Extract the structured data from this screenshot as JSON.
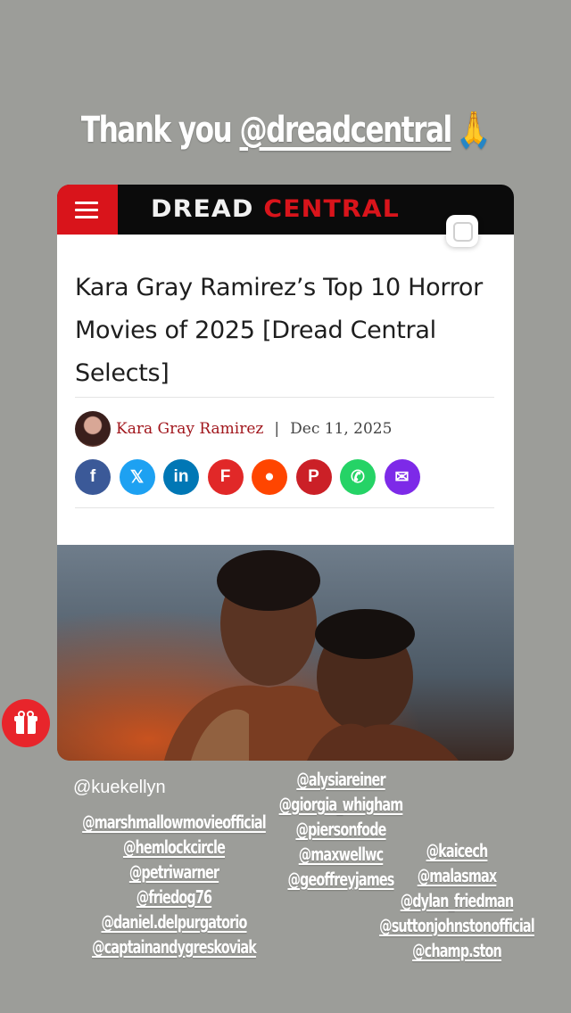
{
  "story": {
    "caption_prefix": "Thank you ",
    "caption_mention": "@dreadcentral",
    "caption_emoji_icon": "folded-hands-emoji"
  },
  "site": {
    "logo_part1": "DREAD",
    "logo_part2": "CENTRAL",
    "brand_red": "#d9141b"
  },
  "article": {
    "title": "Kara Gray Ramirez’s Top 10 Horror Movies of 2025 [Dread Central Selects]",
    "author": "Kara Gray Ramirez",
    "separator": "|",
    "date": "Dec 11, 2025",
    "share_icons": [
      {
        "name": "facebook-icon",
        "glyph": "f",
        "color": "#3b5998"
      },
      {
        "name": "x-icon",
        "glyph": "𝕏",
        "color": "#1da1f2"
      },
      {
        "name": "linkedin-icon",
        "glyph": "in",
        "color": "#0077b5"
      },
      {
        "name": "flipboard-icon",
        "glyph": "F",
        "color": "#e12828"
      },
      {
        "name": "reddit-icon",
        "glyph": "●",
        "color": "#ff4500"
      },
      {
        "name": "pinterest-icon",
        "glyph": "P",
        "color": "#cb2027"
      },
      {
        "name": "whatsapp-icon",
        "glyph": "✆",
        "color": "#25d366"
      },
      {
        "name": "email-icon",
        "glyph": "✉",
        "color": "#7d2ae8"
      }
    ]
  },
  "tags": {
    "plain": "@kuekellyn",
    "left_column": [
      "@marshmallowmovieofficial",
      "@hemlockcircle",
      "@petriwarner",
      "@friedog76",
      "@daniel.delpurgatorio",
      "@captainandygreskoviak"
    ],
    "middle_column": [
      "@alysiareiner",
      "@giorgia_whigham",
      "@piersonfode",
      "@maxwellwc",
      "@geoffreyjames"
    ],
    "right_column": [
      "@kaicech",
      "@malasmax",
      "@dylan_friedman",
      "@suttonjohnstonofficial",
      "@champ.ston"
    ]
  }
}
